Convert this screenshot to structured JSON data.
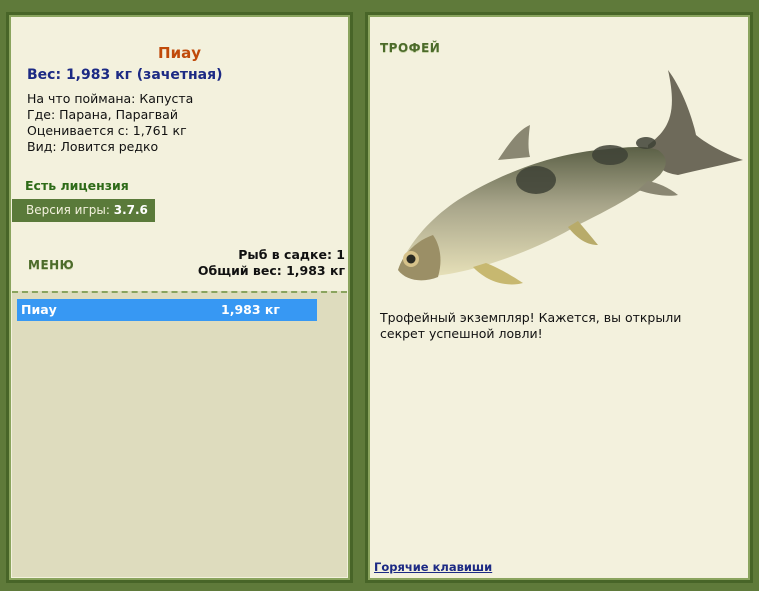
{
  "left": {
    "fish_name": "Пиау",
    "weight_line": "Вес: 1,983 кг (зачетная)",
    "bait_line": "На что поймана: Капуста",
    "where_line": "Где: Парана, Парагвай",
    "rated_line": "Оценивается с: 1,761 кг",
    "type_line": "Вид: Ловится редко",
    "license": "Есть лицензия",
    "version_label": "Версия игры:",
    "version_value": "3.7.6",
    "menu_label": "МЕНЮ",
    "keep_count": "Рыб в садке: 1",
    "keep_weight": "Общий вес: 1,983 кг",
    "list": [
      {
        "name": "Пиау",
        "weight": "1,983 кг"
      }
    ]
  },
  "right": {
    "trophy_title": "ТРОФЕЙ",
    "trophy_text": "Трофейный экземпляр! Кажется, вы открыли секрет успешной ловли!",
    "hotkeys": "Горячие клавиши"
  },
  "colors": {
    "background": "#5f7a3a",
    "panel": "#f3f1dd",
    "border": "#486528",
    "fish_title": "#c04a0a",
    "weight": "#1c2a84",
    "license": "#2e6b18",
    "list_selected": "#3798f3"
  }
}
